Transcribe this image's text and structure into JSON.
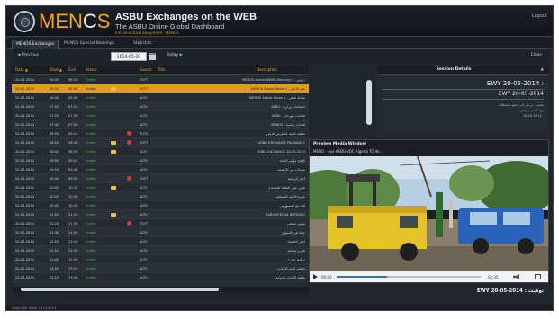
{
  "header": {
    "brand_a": "MEN",
    "brand_b": "C",
    "brand_c": "S",
    "title": "ASBU Exchanges on the WEB",
    "subtitle": "The ASBU Online Global Dashboard",
    "tagline": "EVS Broadcast Equipment - MENOS",
    "logout": "Logout"
  },
  "tabs": [
    "MENOS Exchanges",
    "MENOS Special Bookings",
    "Statistics"
  ],
  "toolbar": {
    "prev_label": "◄ Previous",
    "date_value": "2014-05-20",
    "next_label": "Today ►",
    "close_label": "Close"
  },
  "table": {
    "headers": [
      "Date ▲",
      "Start ▲",
      "End",
      "Status",
      "Source",
      "Title",
      "Description"
    ],
    "rows": [
      {
        "date": "20-05-2014",
        "start": "06:00",
        "end": "06:10",
        "status": "Ended",
        "folder": false,
        "rec": false,
        "source": "EGYT",
        "title": "",
        "desc": "دروس - MENOS Arabic NEWS-Morning 1"
      },
      {
        "date": "20-05-2014",
        "start": "06:20",
        "end": "06:30",
        "status": "Ended",
        "folder": true,
        "rec": false,
        "source": "EGYT",
        "title": "",
        "desc": "منبر الأخبار - MENOS Arabic News 1"
      },
      {
        "date": "20-05-2014",
        "start": "06:40",
        "end": "06:50",
        "status": "Ended",
        "folder": false,
        "rec": false,
        "source": "ALTV",
        "title": "",
        "desc": "نشاط ثقافي - MENOS Arabic News 3"
      },
      {
        "date": "20-05-2014",
        "start": "07:00",
        "end": "07:10",
        "status": "Ended",
        "folder": false,
        "rec": false,
        "source": "ALTV",
        "title": "",
        "desc": "اجتماعات وزارية - ASBU"
      },
      {
        "date": "20-05-2014",
        "start": "07:20",
        "end": "07:30",
        "status": "Ended",
        "folder": false,
        "rec": false,
        "source": "ALTV",
        "title": "",
        "desc": "فعاليات مهرجان - ASBU"
      },
      {
        "date": "20-05-2014",
        "start": "07:40",
        "end": "07:50",
        "status": "Ended",
        "folder": false,
        "rec": false,
        "source": "ALTV",
        "title": "",
        "desc": "لقاءات رياضية - MENOS"
      },
      {
        "date": "20-05-2014",
        "start": "08:00",
        "end": "08:10",
        "status": "Ended",
        "folder": false,
        "rec": true,
        "source": "TUTV",
        "title": "",
        "desc": "تغطية خاصة بالمعرض الدولي"
      },
      {
        "date": "20-05-2014",
        "start": "08:20",
        "end": "08:30",
        "status": "Ended",
        "folder": true,
        "rec": true,
        "source": "EGYT",
        "title": "",
        "desc": "ASBU EXCHANGE PACKAGE 1"
      },
      {
        "date": "20-05-2014",
        "start": "08:40",
        "end": "08:50",
        "status": "Ended",
        "folder": true,
        "rec": false,
        "source": "ALTV",
        "title": "",
        "desc": "ASBU EXCHANGE 20-05-2014"
      },
      {
        "date": "20-05-2014",
        "start": "09:00",
        "end": "09:10",
        "status": "Ended",
        "folder": false,
        "rec": false,
        "source": "ALTV",
        "title": "",
        "desc": "افتتاح مؤتمر الاتحاد"
      },
      {
        "date": "20-05-2014",
        "start": "09:20",
        "end": "09:30",
        "status": "Ended",
        "folder": false,
        "rec": false,
        "source": "ALTV",
        "title": "",
        "desc": "منوعات من الأرشيف"
      },
      {
        "date": "20-05-2014",
        "start": "09:40",
        "end": "09:50",
        "status": "Ended",
        "folder": false,
        "rec": true,
        "source": "EGYT",
        "title": "",
        "desc": "أخبار الرياضة"
      },
      {
        "date": "20-05-2014",
        "start": "10:00",
        "end": "10:10",
        "status": "Ended",
        "folder": true,
        "rec": false,
        "source": "ALTV",
        "title": "",
        "desc": "تقرير حول الطاقة المتجددة"
      },
      {
        "date": "20-05-2014",
        "start": "10:20",
        "end": "10:30",
        "status": "Ended",
        "folder": false,
        "rec": false,
        "source": "ALTV",
        "title": "",
        "desc": "نشرة الأخبار المسائية"
      },
      {
        "date": "20-05-2014",
        "start": "10:40",
        "end": "10:50",
        "status": "Ended",
        "folder": false,
        "rec": false,
        "source": "ALTV",
        "title": "",
        "desc": "لقاء مع المسؤولين"
      },
      {
        "date": "20-05-2014",
        "start": "11:00",
        "end": "11:10",
        "status": "Ended",
        "folder": true,
        "rec": false,
        "source": "ALTV",
        "title": "",
        "desc": "ASBU SPECIAL BOOKING"
      },
      {
        "date": "20-05-2014",
        "start": "11:20",
        "end": "11:30",
        "status": "Ended",
        "folder": false,
        "rec": true,
        "source": "EGYT",
        "title": "",
        "desc": "مؤتمر صحفي"
      },
      {
        "date": "20-05-2014",
        "start": "11:40",
        "end": "11:50",
        "status": "Ended",
        "folder": false,
        "rec": false,
        "source": "ALTV",
        "title": "",
        "desc": "جولة في الأسواق"
      },
      {
        "date": "20-05-2014",
        "start": "12:00",
        "end": "12:10",
        "status": "Ended",
        "folder": false,
        "rec": false,
        "source": "ALTV",
        "title": "",
        "desc": "أخبار الاقتصاد"
      },
      {
        "date": "20-05-2014",
        "start": "12:20",
        "end": "12:30",
        "status": "Ended",
        "folder": false,
        "rec": false,
        "source": "ALTV",
        "title": "",
        "desc": "تقارير ميدانية"
      },
      {
        "date": "20-05-2014",
        "start": "12:40",
        "end": "12:50",
        "status": "Ended",
        "folder": false,
        "rec": false,
        "source": "ALTV",
        "title": "",
        "desc": "برنامج حواري"
      },
      {
        "date": "20-05-2014",
        "start": "13:00",
        "end": "13:10",
        "status": "Ended",
        "folder": false,
        "rec": false,
        "source": "ALTV",
        "title": "",
        "desc": "ملخص اليوم الإخباري"
      },
      {
        "date": "20-05-2014",
        "start": "13:20",
        "end": "13:30",
        "status": "Ended",
        "folder": false,
        "rec": false,
        "source": "ALTV",
        "title": "",
        "desc": "تغطية الأحداث الدولية"
      }
    ],
    "selected_index": 1
  },
  "session": {
    "title": "Session Details",
    "collapse": "▲",
    "line1": "EWY 20-05-2014 :",
    "line2": "EWY 20-05-2014",
    "meta": [
      "مصدر : ترسل إلى جميع المحطات",
      "نوع الحجز : عادي",
      "20-05-2014 :"
    ]
  },
  "media": {
    "title": "Preview Media Window",
    "caption": "MENO - Aus-ASBU-VOC Algeria TC de...",
    "time_current": "00:00",
    "time_total": "02:35",
    "progress_fraction": 0.35
  },
  "footer": {
    "date_label": "EWY 20-05-2014 : توقيت",
    "copyright": "Copyright ASBU 2013-2014"
  },
  "colors": {
    "accent": "#e49a1e",
    "status_ok": "#47c24a",
    "brand_orange": "#f2a81d"
  }
}
